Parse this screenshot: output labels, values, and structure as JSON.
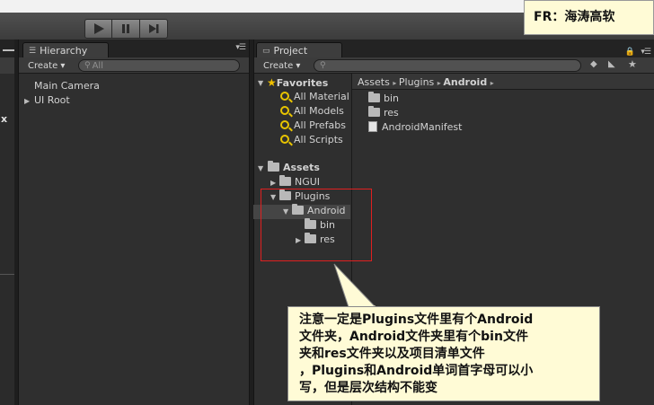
{
  "annotation_top": "FR：海涛高软",
  "toolbar": {
    "play": "play-icon",
    "pause": "pause-icon",
    "step": "step-icon"
  },
  "left_panel": {
    "stub": "x"
  },
  "hierarchy": {
    "tab_label": "Hierarchy",
    "create_label": "Create ▾",
    "search_placeholder": "All",
    "items": [
      "Main Camera",
      "UI Root"
    ]
  },
  "project": {
    "tab_label": "Project",
    "create_label": "Create ▾",
    "favorites": {
      "label": "Favorites",
      "items": [
        "All Material",
        "All Models",
        "All Prefabs",
        "All Scripts"
      ]
    },
    "assets": {
      "label": "Assets",
      "tree": [
        "NGUI",
        "Plugins",
        "Android",
        "bin",
        "res"
      ]
    },
    "breadcrumb": [
      "Assets",
      "Plugins",
      "Android"
    ],
    "contents": [
      "bin",
      "res",
      "AndroidManifest"
    ]
  },
  "annotation_callout": {
    "lines": [
      "注意一定是Plugins文件里有个Android",
      "文件夹，Android文件夹里有个bin文件",
      "夹和res文件夹以及项目清单文件",
      "，Plugins和Android单词首字母可以小",
      "写，但是层次结构不能变"
    ]
  },
  "colors": {
    "note_bg": "#fffbd6",
    "highlight_border": "#e02020",
    "favorite_star": "#f0c000"
  }
}
